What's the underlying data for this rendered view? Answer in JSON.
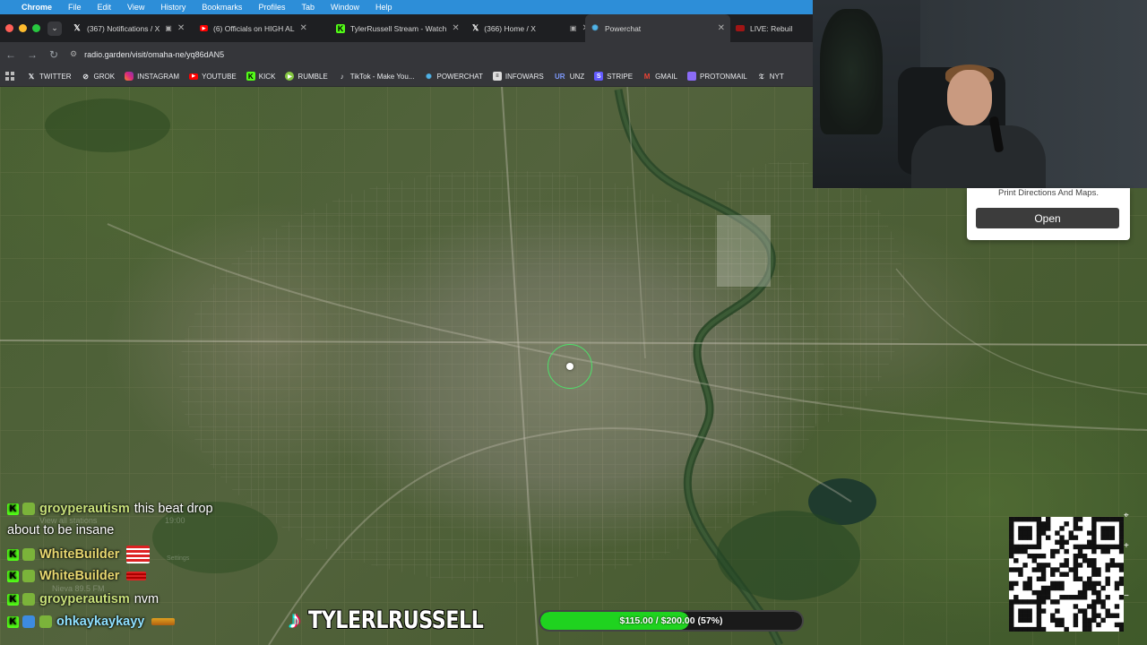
{
  "menubar": {
    "app": "Chrome",
    "items": [
      "File",
      "Edit",
      "View",
      "History",
      "Bookmarks",
      "Profiles",
      "Tab",
      "Window",
      "Help"
    ]
  },
  "tabs": [
    {
      "title": "(367) Notifications / X",
      "icon": "x-icon"
    },
    {
      "title": "(6) Officials on HIGH AL",
      "icon": "youtube-icon"
    },
    {
      "title": "TylerRussell Stream - Watch",
      "icon": "kick-icon"
    },
    {
      "title": "(366) Home / X",
      "icon": "x-icon"
    },
    {
      "title": "Powerchat",
      "icon": "powerchat-icon"
    },
    {
      "title": "LIVE: Rebuil",
      "icon": "live-icon"
    }
  ],
  "address": {
    "url": "radio.garden/visit/omaha-ne/yq86dAN5"
  },
  "bookmarks": [
    {
      "label": "TWITTER",
      "icon": "x-icon",
      "color": "#ffffff"
    },
    {
      "label": "GROK",
      "icon": "grok-icon",
      "color": "#ffffff"
    },
    {
      "label": "INSTAGRAM",
      "icon": "instagram-icon",
      "color": "#e1306c"
    },
    {
      "label": "YOUTUBE",
      "icon": "youtube-icon",
      "color": "#ff0000"
    },
    {
      "label": "KICK",
      "icon": "kick-icon",
      "color": "#53fc18"
    },
    {
      "label": "RUMBLE",
      "icon": "rumble-icon",
      "color": "#85c742"
    },
    {
      "label": "TikTok - Make You...",
      "icon": "tiktok-icon",
      "color": "#ffffff"
    },
    {
      "label": "POWERCHAT",
      "icon": "powerchat-icon",
      "color": "#4fb3e8"
    },
    {
      "label": "INFOWARS",
      "icon": "infowars-icon",
      "color": "#ffffff"
    },
    {
      "label": "UNZ",
      "icon": "unz-icon",
      "color": "#4a6fd8"
    },
    {
      "label": "STRIPE",
      "icon": "stripe-icon",
      "color": "#635bff"
    },
    {
      "label": "GMAIL",
      "icon": "gmail-icon",
      "color": "#ea4335"
    },
    {
      "label": "PROTONMAIL",
      "icon": "protonmail-icon",
      "color": "#8b6cf7"
    },
    {
      "label": "NYT",
      "icon": "nyt-icon",
      "color": "#ffffff"
    }
  ],
  "popup": {
    "text": "Print Directions And Maps.",
    "button": "Open"
  },
  "chat": {
    "ghost": {
      "station_link": "View all stations",
      "time": "19:00",
      "settings": "Settings",
      "station": "Nieva 89.5 FM"
    },
    "messages": [
      {
        "user": "groyperautism",
        "text": "this beat drop",
        "user_color": "#c8e07a",
        "badge_color": "#7bb33a"
      },
      {
        "user": "",
        "text": "about to be insane",
        "user_color": "#ffffff",
        "badge_color": ""
      },
      {
        "user": "WhiteBuilder",
        "text": "",
        "user_color": "#e8d770",
        "badge_color": "#7bb33a",
        "emote": "emote-flag"
      },
      {
        "user": "WhiteBuilder",
        "text": "",
        "user_color": "#e8d770",
        "badge_color": "#7bb33a",
        "emote": "emote-flag-small"
      },
      {
        "user": "groyperautism",
        "text": "nvm",
        "user_color": "#c8e07a",
        "badge_color": "#7bb33a"
      },
      {
        "user": "ohkaykaykayy",
        "text": "",
        "user_color": "#8fe0ff",
        "badge_color": "#3d8be0",
        "emote": "emote-bar"
      }
    ]
  },
  "tiktok": {
    "handle": "TYLERLRUSSELL"
  },
  "goal": {
    "text": "$115.00 / $200.00 (57%)",
    "progress": 0.57,
    "fill_color": "#1fd31f"
  },
  "colors": {
    "marker": "#4ee06a",
    "menubar": "#2d8ed8"
  }
}
